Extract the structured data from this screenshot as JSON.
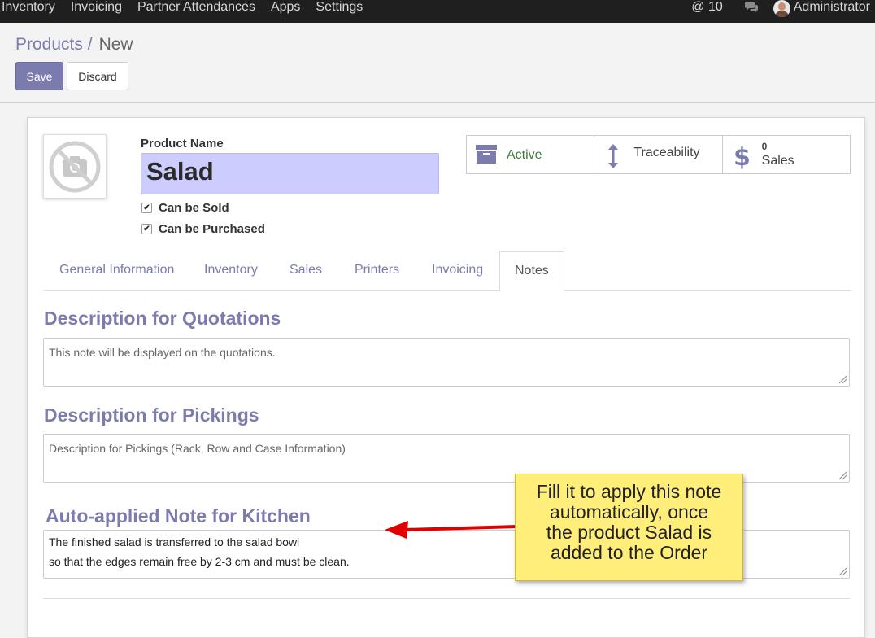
{
  "navbar": {
    "menu": [
      "Inventory",
      "Invoicing",
      "Partner Attendances",
      "Apps",
      "Settings"
    ],
    "mentions": "@ 10",
    "user": "Administrator"
  },
  "breadcrumb": {
    "parent": "Products",
    "separator": "/",
    "current": "New"
  },
  "actions": {
    "save": "Save",
    "discard": "Discard"
  },
  "product": {
    "name_label": "Product Name",
    "name": "Salad",
    "can_be_sold": "Can be Sold",
    "can_be_purchased": "Can be Purchased"
  },
  "smart_buttons": {
    "active": "Active",
    "traceability": "Traceability",
    "sales_count": "0",
    "sales_label": "Sales"
  },
  "tabs": [
    "General Information",
    "Inventory",
    "Sales",
    "Printers",
    "Invoicing",
    "Notes"
  ],
  "active_tab": "Notes",
  "notes": {
    "quotations_title": "Description for Quotations",
    "quotations_placeholder": "This note will be displayed on the quotations.",
    "pickings_title": "Description for Pickings",
    "pickings_placeholder": "Description for Pickings (Rack, Row and Case Information)",
    "kitchen_title": "Auto-applied Note for Kitchen",
    "kitchen_line1": "The finished salad is transferred to the salad bowl",
    "kitchen_line2": "so that the edges remain free by 2-3 cm and must be clean."
  },
  "callout": {
    "line1": "Fill it to apply this note",
    "line2": "automatically, once",
    "line3": "the product Salad is",
    "line4": "added to the Order"
  },
  "colors": {
    "accent": "#7c7bad",
    "navbar": "#1f1f1f",
    "name_field": "#ccccff",
    "active_text": "#3d7d3d",
    "callout": "#ffee7a",
    "arrow": "#e00000"
  }
}
